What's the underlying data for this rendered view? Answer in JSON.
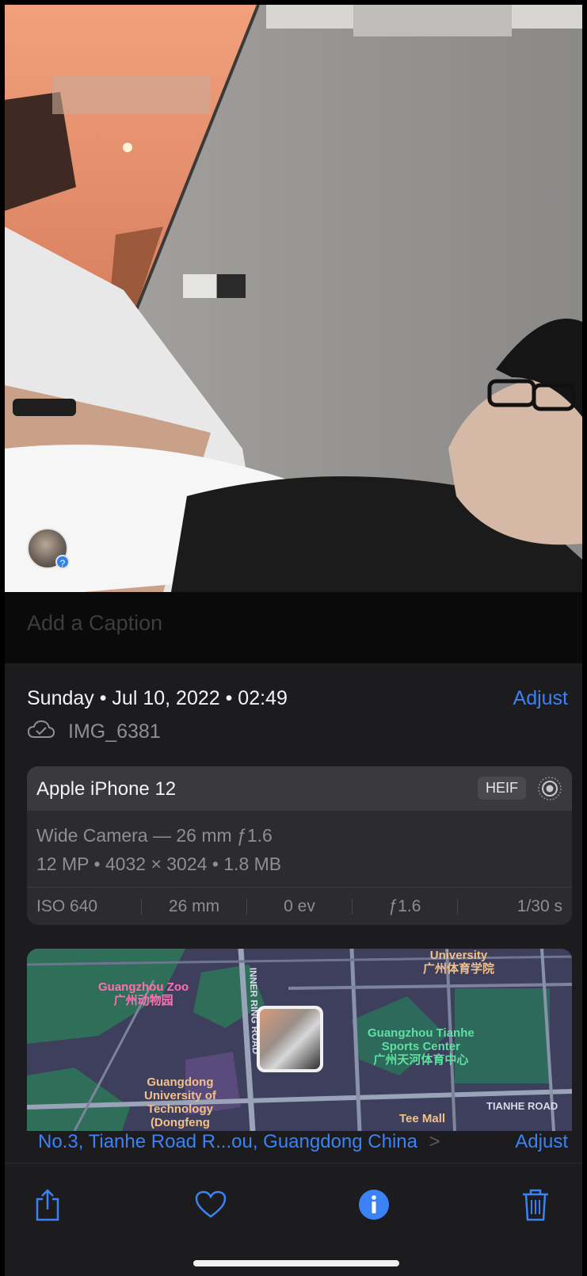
{
  "photo": {
    "face_badge": "?"
  },
  "caption": {
    "placeholder": "Add a Caption"
  },
  "info": {
    "datetime": "Sunday • Jul 10, 2022 • 02:49",
    "adjust_label": "Adjust",
    "filename": "IMG_6381",
    "camera": {
      "device": "Apple iPhone 12",
      "format_badge": "HEIF",
      "lens": "Wide Camera — 26 mm ƒ1.6",
      "specs": "12 MP • 4032 × 3024 • 1.8 MB",
      "exif": {
        "iso": "ISO 640",
        "focal": "26 mm",
        "ev": "0 ev",
        "aperture": "ƒ1.6",
        "shutter": "1/30 s"
      }
    },
    "map": {
      "labels": {
        "zoo": "Guangzhou Zoo\n广州动物园",
        "university_top": "University\n广州体育学院",
        "sports_center": "Guangzhou Tianhe\nSports Center\n广州天河体育中心",
        "gdut": "Guangdong\nUniversity of\nTechnology\n(Dongfeng",
        "inner_ring": "INNER RING ROAD",
        "tianhe_road": "TIANHE ROAD",
        "tee_mall": "Tee Mall"
      }
    },
    "address": "No.3, Tianhe Road R...ou, Guangdong China",
    "address_chevron": ">",
    "address_adjust": "Adjust"
  },
  "toolbar": {
    "share": "share-icon",
    "favorite": "heart-icon",
    "info": "info-icon",
    "delete": "trash-icon"
  },
  "colors": {
    "accent": "#3b82f6",
    "background": "#1c1c1e",
    "card": "#2c2c2e"
  }
}
